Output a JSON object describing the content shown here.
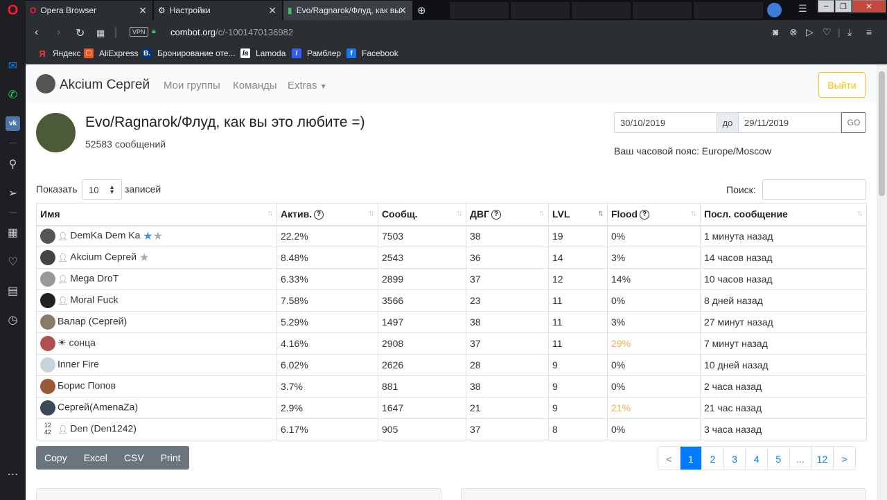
{
  "browser": {
    "tabs": [
      {
        "label": "Opera Browser"
      },
      {
        "label": "Настройки"
      },
      {
        "label": "Evo/Ragnarok/Флуд, как вы"
      }
    ],
    "url_host": "combot.org",
    "url_path": "/c/-1001470136982",
    "vpn_label": "VPN",
    "bookmarks": [
      "Яндекс",
      "AliExpress",
      "Бронирование оте...",
      "Lamoda",
      "Рамблер",
      "Facebook"
    ]
  },
  "nav": {
    "username": "Akcium Сергей",
    "links": [
      "Мои группы",
      "Команды",
      "Extras"
    ],
    "logout": "Выйти"
  },
  "group": {
    "title": "Evo/Ragnarok/Флуд, как вы это любите =)",
    "messages": "52583 сообщений",
    "date_from": "30/10/2019",
    "date_sep": "до",
    "date_to": "29/11/2019",
    "go": "GO",
    "timezone": "Ваш часовой пояс: Europe/Moscow"
  },
  "table_controls": {
    "show_label": "Показать",
    "show_value": "10",
    "records_label": "записей",
    "search_label": "Поиск:"
  },
  "columns": [
    "Имя",
    "Актив.",
    "Сообщ.",
    "ДВГ",
    "LVL",
    "Flood",
    "Посл. сообщение"
  ],
  "rows": [
    {
      "name": "DemKa Dem Ka",
      "act": "22.2%",
      "msg": "7503",
      "dvg": "38",
      "lvl": "19",
      "flood": "0%",
      "last": "1 минута назад"
    },
    {
      "name": "Akcium Сергей",
      "act": "8.48%",
      "msg": "2543",
      "dvg": "36",
      "lvl": "14",
      "flood": "3%",
      "last": "14 часов назад"
    },
    {
      "name": "Mega DroT",
      "act": "6.33%",
      "msg": "2899",
      "dvg": "37",
      "lvl": "12",
      "flood": "14%",
      "last": "10 часов назад"
    },
    {
      "name": "Moral Fuck",
      "act": "7.58%",
      "msg": "3566",
      "dvg": "23",
      "lvl": "11",
      "flood": "0%",
      "last": "8 дней назад"
    },
    {
      "name": "Валар (Сергей)",
      "act": "5.29%",
      "msg": "1497",
      "dvg": "38",
      "lvl": "11",
      "flood": "3%",
      "last": "27 минут назад"
    },
    {
      "name": "☀ сонца",
      "act": "4.16%",
      "msg": "2908",
      "dvg": "37",
      "lvl": "11",
      "flood": "29%",
      "last": "7 минут назад"
    },
    {
      "name": "Inner Fire",
      "act": "6.02%",
      "msg": "2626",
      "dvg": "28",
      "lvl": "9",
      "flood": "0%",
      "last": "10 дней назад"
    },
    {
      "name": "Борис Попов",
      "act": "3.7%",
      "msg": "881",
      "dvg": "38",
      "lvl": "9",
      "flood": "0%",
      "last": "2 часа назад"
    },
    {
      "name": "Сергей(AmenaZa)",
      "act": "2.9%",
      "msg": "1647",
      "dvg": "21",
      "lvl": "9",
      "flood": "21%",
      "last": "21 час назад"
    },
    {
      "name": "Den (Den1242)",
      "act": "6.17%",
      "msg": "905",
      "dvg": "37",
      "lvl": "8",
      "flood": "0%",
      "last": "3 часа назад"
    }
  ],
  "export_buttons": [
    "Copy",
    "Excel",
    "CSV",
    "Print"
  ],
  "pager": [
    "<",
    "1",
    "2",
    "3",
    "4",
    "5",
    "...",
    "12",
    ">"
  ],
  "colors": {
    "accent": "#007bff",
    "warning": "#f0ad4e",
    "logout": "#ffc107"
  }
}
